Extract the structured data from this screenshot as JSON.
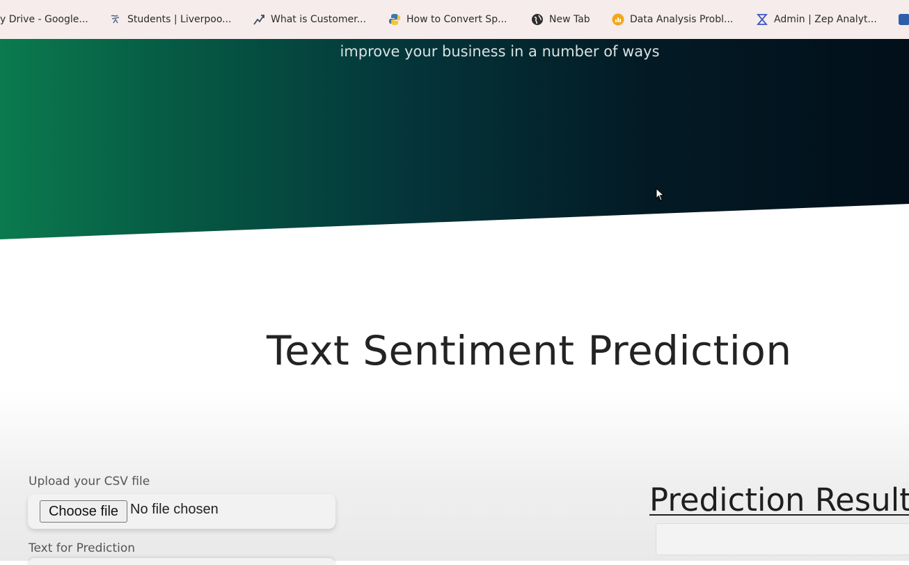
{
  "bookmarks": [
    {
      "label": "y Drive - Google...",
      "icon": "drive-icon"
    },
    {
      "label": "Students | Liverpoo...",
      "icon": "liverpool-icon"
    },
    {
      "label": "What is Customer...",
      "icon": "trend-icon"
    },
    {
      "label": "How to Convert Sp...",
      "icon": "python-icon"
    },
    {
      "label": "New Tab",
      "icon": "globe-icon"
    },
    {
      "label": "Data Analysis Probl...",
      "icon": "chart-badge-icon"
    },
    {
      "label": "Admin | Zep Analyt...",
      "icon": "hourglass-icon"
    }
  ],
  "hero": {
    "subtitle": "improve your business in a number of ways",
    "gradient_start": "#0b7a4f",
    "gradient_end": "#020f1a"
  },
  "main": {
    "title": "Text Sentiment Prediction",
    "upload_label": "Upload your CSV file",
    "file_button_label": "Choose file",
    "file_status": "No file chosen",
    "text_label": "Text for Prediction",
    "result_heading": "Prediction Result",
    "result_value": ""
  }
}
